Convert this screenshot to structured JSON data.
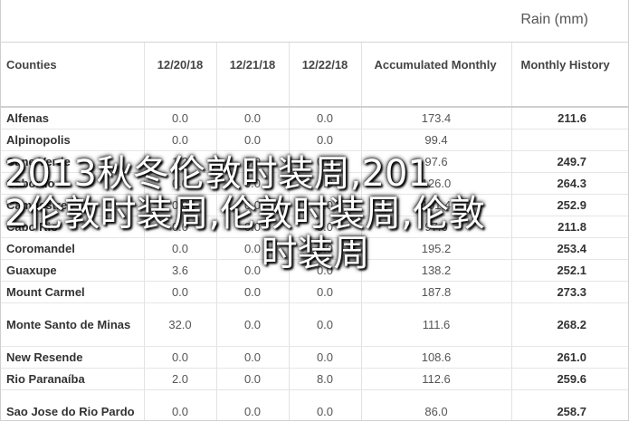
{
  "header": {
    "title": "Rain (mm)"
  },
  "table": {
    "columns": [
      "Counties",
      "12/20/18",
      "12/21/18",
      "12/22/18",
      "Accumulated Monthly",
      "Monthly History"
    ],
    "rows": [
      {
        "county": "Alfenas",
        "d1": "0.0",
        "d2": "0.0",
        "d3": "0.0",
        "acc": "173.4",
        "hist": "211.6"
      },
      {
        "county": "Alpinopolis",
        "d1": "0.0",
        "d2": "0.0",
        "d3": "0.0",
        "acc": "99.4",
        "hist": ""
      },
      {
        "county": "Cane Verde",
        "d1": "1.2",
        "d2": "0.0",
        "d3": "0.0",
        "acc": "97.6",
        "hist": "249.7"
      },
      {
        "county": "Cabordo",
        "d1": "0.0",
        "d2": "0.0",
        "d3": "0.0",
        "acc": "126.0",
        "hist": "264.3"
      },
      {
        "county": "Campestre",
        "d1": "0.0",
        "d2": "0.0",
        "d3": "0.0",
        "acc": "101.4",
        "hist": "252.9"
      },
      {
        "county": "Cabo Rio",
        "d1": "0.0",
        "d2": "0.0",
        "d3": "0.0",
        "acc": "97.6",
        "hist": "211.8"
      },
      {
        "county": "Coromandel",
        "d1": "0.0",
        "d2": "0.0",
        "d3": "0.0",
        "acc": "195.2",
        "hist": "253.4"
      },
      {
        "county": "Guaxupe",
        "d1": "3.6",
        "d2": "0.0",
        "d3": "0.0",
        "acc": "138.2",
        "hist": "252.1"
      },
      {
        "county": "Mount Carmel",
        "d1": "0.0",
        "d2": "0.0",
        "d3": "0.0",
        "acc": "187.8",
        "hist": "273.3"
      },
      {
        "county": "Monte Santo de Minas",
        "d1": "32.0",
        "d2": "0.0",
        "d3": "0.0",
        "acc": "111.6",
        "hist": "268.2"
      },
      {
        "county": "New Resende",
        "d1": "0.0",
        "d2": "0.0",
        "d3": "0.0",
        "acc": "108.6",
        "hist": "261.0"
      },
      {
        "county": "Rio Paranaíba",
        "d1": "2.0",
        "d2": "0.0",
        "d3": "8.0",
        "acc": "112.6",
        "hist": "259.6"
      },
      {
        "county": "Sao Jose do Rio Pardo",
        "d1": "0.0",
        "d2": "0.0",
        "d3": "0.0",
        "acc": "86.0",
        "hist": "258.7"
      }
    ]
  },
  "watermark": {
    "line1": "2013秋冬伦敦时装周,201",
    "line2": "2伦敦时装周,伦敦时装周,伦敦",
    "line3": "时装周"
  }
}
